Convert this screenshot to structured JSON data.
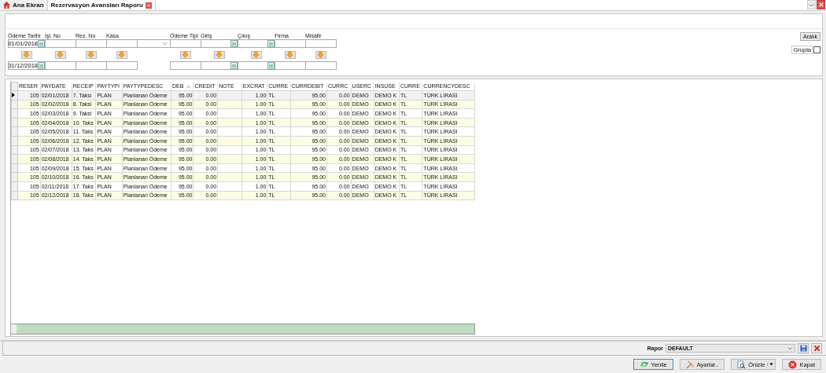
{
  "tabs": [
    {
      "label": "Ana Ekran",
      "selected": false
    },
    {
      "label": "Rezervasyon Avansları Raporu",
      "selected": true
    }
  ],
  "filters": [
    {
      "kind": "date",
      "label": "Ödeme Tarihi",
      "from": "01/01/2018",
      "to": "31/12/2018"
    },
    {
      "kind": "text",
      "label": "İşl. No"
    },
    {
      "kind": "text",
      "label": "Rez. No"
    },
    {
      "kind": "text",
      "label": "Kasa"
    },
    {
      "kind": "select"
    },
    {
      "kind": "text",
      "label": "Ödeme Tipi"
    },
    {
      "kind": "date",
      "label": "Giriş"
    },
    {
      "kind": "date",
      "label": "Çıkış"
    },
    {
      "kind": "text",
      "label": "Firma"
    },
    {
      "kind": "text",
      "label": "Misafir"
    }
  ],
  "range_button": "Aralık",
  "group": {
    "label": "Grupla",
    "checked": false
  },
  "table": {
    "columns": [
      {
        "label": "RESER",
        "sorted": false
      },
      {
        "label": "PAYDATE",
        "sorted": false
      },
      {
        "label": "RECEIP",
        "sorted": false
      },
      {
        "label": "PAYTYPI",
        "sorted": false
      },
      {
        "label": "PAYTYPEDESC",
        "sorted": false
      },
      {
        "label": "DEB",
        "sorted": true
      },
      {
        "label": "CREDIT",
        "sorted": false
      },
      {
        "label": "NOTE",
        "sorted": false
      },
      {
        "label": "EXCRAT",
        "sorted": false
      },
      {
        "label": "CURRE",
        "sorted": false
      },
      {
        "label": "CURRDEBIT",
        "sorted": false
      },
      {
        "label": "CURRC",
        "sorted": false
      },
      {
        "label": "USERC",
        "sorted": false
      },
      {
        "label": "INSUSE",
        "sorted": false
      },
      {
        "label": "CURRE",
        "sorted": false
      },
      {
        "label": "CURRENCYDESC",
        "sorted": false
      }
    ],
    "rows": [
      {
        "selected": true,
        "cells": [
          "105",
          "02/01/2018",
          "7. Taksi",
          "PLAN",
          "Planlanan Ödeme",
          "95.00",
          "0.00",
          "",
          "1.00",
          "TL",
          "95.00",
          "0.00",
          "DEMO",
          "DEMO K",
          "TL",
          "TÜRK LİRASI"
        ]
      },
      {
        "selected": false,
        "cells": [
          "105",
          "02/02/2018",
          "8. Taksi",
          "PLAN",
          "Planlanan Ödeme",
          "95.00",
          "0.00",
          "",
          "1.00",
          "TL",
          "95.00",
          "0.00",
          "DEMO",
          "DEMO K",
          "TL",
          "TÜRK LİRASI"
        ]
      },
      {
        "selected": false,
        "cells": [
          "105",
          "02/03/2018",
          "9. Taksi",
          "PLAN",
          "Planlanan Ödeme",
          "95.00",
          "0.00",
          "",
          "1.00",
          "TL",
          "95.00",
          "0.00",
          "DEMO",
          "DEMO K",
          "TL",
          "TÜRK LİRASI"
        ]
      },
      {
        "selected": false,
        "cells": [
          "105",
          "02/04/2018",
          "10. Taks",
          "PLAN",
          "Planlanan Ödeme",
          "95.00",
          "0.00",
          "",
          "1.00",
          "TL",
          "95.00",
          "0.00",
          "DEMO",
          "DEMO K",
          "TL",
          "TÜRK LİRASI"
        ]
      },
      {
        "selected": false,
        "cells": [
          "105",
          "02/05/2018",
          "11. Taks",
          "PLAN",
          "Planlanan Ödeme",
          "95.00",
          "0.00",
          "",
          "1.00",
          "TL",
          "95.00",
          "0.00",
          "DEMO",
          "DEMO K",
          "TL",
          "TÜRK LİRASI"
        ]
      },
      {
        "selected": false,
        "cells": [
          "105",
          "02/06/2018",
          "12. Taks",
          "PLAN",
          "Planlanan Ödeme",
          "95.00",
          "0.00",
          "",
          "1.00",
          "TL",
          "95.00",
          "0.00",
          "DEMO",
          "DEMO K",
          "TL",
          "TÜRK LİRASI"
        ]
      },
      {
        "selected": false,
        "cells": [
          "105",
          "02/07/2018",
          "13. Taks",
          "PLAN",
          "Planlanan Ödeme",
          "95.00",
          "0.00",
          "",
          "1.00",
          "TL",
          "95.00",
          "0.00",
          "DEMO",
          "DEMO K",
          "TL",
          "TÜRK LİRASI"
        ]
      },
      {
        "selected": false,
        "cells": [
          "105",
          "02/08/2018",
          "14. Taks",
          "PLAN",
          "Planlanan Ödeme",
          "95.00",
          "0.00",
          "",
          "1.00",
          "TL",
          "95.00",
          "0.00",
          "DEMO",
          "DEMO K",
          "TL",
          "TÜRK LİRASI"
        ]
      },
      {
        "selected": false,
        "cells": [
          "105",
          "02/09/2018",
          "15. Taks",
          "PLAN",
          "Planlanan Ödeme",
          "95.00",
          "0.00",
          "",
          "1.00",
          "TL",
          "95.00",
          "0.00",
          "DEMO",
          "DEMO K",
          "TL",
          "TÜRK LİRASI"
        ]
      },
      {
        "selected": false,
        "cells": [
          "105",
          "02/10/2018",
          "16. Taks",
          "PLAN",
          "Planlanan Ödeme",
          "95.00",
          "0.00",
          "",
          "1.00",
          "TL",
          "95.00",
          "0.00",
          "DEMO",
          "DEMO K",
          "TL",
          "TÜRK LİRASI"
        ]
      },
      {
        "selected": false,
        "cells": [
          "105",
          "02/11/2018",
          "17. Taks",
          "PLAN",
          "Planlanan Ödeme",
          "95.00",
          "0.00",
          "",
          "1.00",
          "TL",
          "95.00",
          "0.00",
          "DEMO",
          "DEMO K",
          "TL",
          "TÜRK LİRASI"
        ]
      },
      {
        "selected": false,
        "cells": [
          "105",
          "02/12/2018",
          "18. Taks",
          "PLAN",
          "Planlanan Ödeme",
          "95.00",
          "0.00",
          "",
          "1.00",
          "TL",
          "95.00",
          "0.00",
          "DEMO",
          "DEMO K",
          "TL",
          "TÜRK LİRASI"
        ]
      }
    ]
  },
  "report": {
    "label": "Rapor",
    "value": "DEFAULT"
  },
  "buttons": [
    {
      "kind": "refresh",
      "label": "Yenile",
      "focused": true
    },
    {
      "kind": "settings",
      "label": "Ayarlar..",
      "focused": false
    },
    {
      "kind": "preview",
      "label": "Önizle",
      "focused": false
    },
    {
      "kind": "close",
      "label": "Kapat",
      "focused": false
    }
  ]
}
